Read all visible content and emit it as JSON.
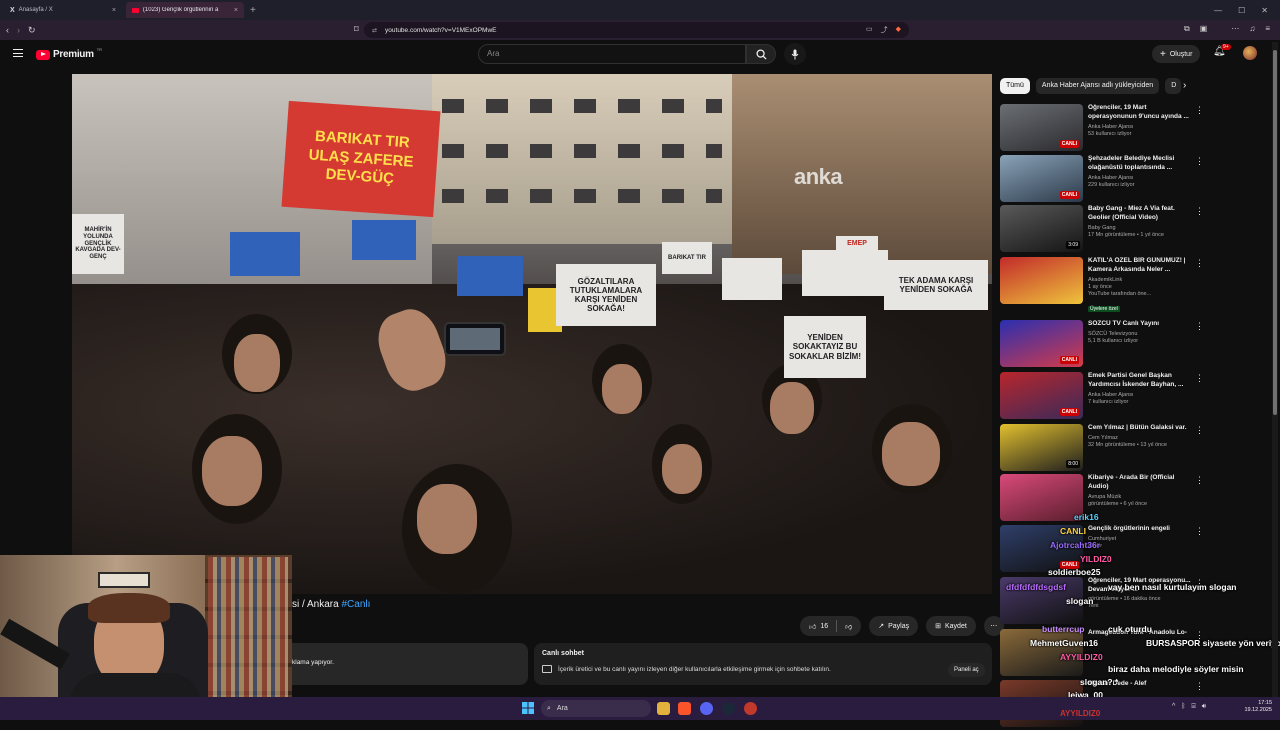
{
  "browser": {
    "tabs": [
      {
        "title": "Anasayfa / X",
        "icon": "x-logo-icon"
      },
      {
        "title": "(1023) Gençlik örgütlerinin a",
        "icon": "youtube-icon"
      }
    ],
    "url": "youtube.com/watch?v=V1MExOPMwE"
  },
  "header": {
    "logo": "Premium",
    "logo_region": "TR",
    "search_placeholder": "Ara",
    "create_label": "Oluştur",
    "notifications": "9+"
  },
  "video": {
    "watermark": "anka",
    "banner": [
      "BARIKAT TIR",
      "ULAŞ ZAFERE",
      "DEV-GÜÇ"
    ],
    "signs": [
      "MAHİR'İN YOLUNDA GENÇLİK KAVGADA DEV-GENÇ",
      "GÖZALTILARA TUTUKLAMALARA KARŞI YENİDEN SOKAĞA!",
      "TEK ADAMA KARŞI YENİDEN SOKAĞA",
      "YENİDEN SOKAKTAYIZ BU SOKAKLAR BİZİM!",
      "BARIKAT TIR",
      "EMEP"
    ],
    "title_visible": "si / Ankara ",
    "title_tag": "#Canlı",
    "likes": "16",
    "share": "Paylaş",
    "save": "Kaydet",
    "desc_visible": "klama yapıyor."
  },
  "live_chat": {
    "title": "Canlı sohbet",
    "desc": "İçerik üretici ve bu canlı yayını izleyen diğer kullanıcılarla etkileşime girmek için sohbete katılın.",
    "open_label": "Paneli aç"
  },
  "chips": [
    "Tümü",
    "Anka Haber Ajansı adlı yükleyiciden",
    "D"
  ],
  "recommended": [
    {
      "title": "Öğrenciler, 19 Mart operasyonunun 9'uncu ayında ...",
      "channel": "Anka Haber Ajansı",
      "meta": "53 kullanıcı izliyor",
      "badge": "CANLI",
      "extra": "",
      "green": ""
    },
    {
      "title": "Şehzadeler Belediye Meclisi olağanüstü toplantısında ...",
      "channel": "Anka Haber Ajansı",
      "meta": "229 kullanıcı izliyor",
      "badge": "CANLI",
      "extra": "",
      "green": ""
    },
    {
      "title": "Baby Gang - Miez A Via feat. Geolier (Official Video)",
      "channel": "Baby Gang",
      "meta": "17 Mn görüntüleme • 1 yıl önce",
      "badge": "3:09",
      "extra": "",
      "green": ""
    },
    {
      "title": "KATIL'A ÖZEL BİR GÜNÜMÜZ! | Kamera Arkasında Neler ...",
      "channel": "AkademikLink",
      "meta": "1 ay önce",
      "badge": "",
      "extra": "YouTube tarafından öne...",
      "green": "Üyelere özel"
    },
    {
      "title": "SÖZCÜ TV Canlı Yayını",
      "channel": "SÖZCÜ Televizyonu",
      "meta": "5,1 B kullanıcı izliyor",
      "badge": "CANLI",
      "extra": "",
      "green": ""
    },
    {
      "title": "Emek Partisi Genel Başkan Yardımcısı İskender Bayhan, ...",
      "channel": "Anka Haber Ajansı",
      "meta": "7 kullanıcı izliyor",
      "badge": "CANLI",
      "extra": "",
      "green": ""
    },
    {
      "title": "Cem Yılmaz | Bütün Galaksi var.",
      "channel": "Cem Yılmaz",
      "meta": "32 Mn görüntüleme • 13 yıl önce",
      "badge": "8:00",
      "extra": "",
      "green": ""
    },
    {
      "title": "Kibariye - Arada Bir (Official Audio)",
      "channel": "Avrupa Müzik",
      "meta": "görüntüleme • 6 yıl önce",
      "badge": "",
      "extra": "",
      "green": ""
    },
    {
      "title": "Gençlik örgütlerinin engeli",
      "channel": "Cumhuriyet",
      "meta": "izliyor",
      "badge": "CANLI",
      "extra": "",
      "green": ""
    },
    {
      "title": "Öğrenciler, 19 Mart operasyonu... Devam ediyor ...",
      "channel": "",
      "meta": "görüntüleme • 16 dakika önce",
      "badge": "",
      "extra": "Yeni",
      "green": ""
    },
    {
      "title": "Armageddon Turk - Anadolu Lo-",
      "channel": "",
      "meta": "",
      "badge": "",
      "extra": "",
      "green": ""
    },
    {
      "title": "Mercan Dede - Alef",
      "channel": "",
      "meta": "",
      "badge": "",
      "extra": "",
      "green": ""
    }
  ],
  "stream_chat": [
    {
      "text": "erik16",
      "color": "#5ad1ff"
    },
    {
      "text": "CANLI",
      "color": "#ffd23f"
    },
    {
      "text": "Ajotrcaht36r",
      "color": "#9b6bff"
    },
    {
      "text": "YILDIZ0",
      "color": "#ff5aa5"
    },
    {
      "text": "soldierboe25",
      "color": "#ffffff"
    },
    {
      "text": "dfdfdfdfdsgdsf",
      "color": "#b86bff"
    },
    {
      "text": "vay ben nasıl kurtulayım slogan",
      "color": "#ffffff"
    },
    {
      "text": "slogan",
      "color": "#ffffff"
    },
    {
      "text": "butterrcup",
      "color": "#c58cff"
    },
    {
      "text": "cuk oturdu",
      "color": "#ffffff"
    },
    {
      "text": "MehmetGuven16",
      "color": "#ffffff"
    },
    {
      "text": "BURSASPOR siyasete yön veriyor",
      "color": "#ffffff"
    },
    {
      "text": "AYYILDIZ0",
      "color": "#ff5aa5"
    },
    {
      "text": "biraz daha melodiyle söyler misin",
      "color": "#ffffff"
    },
    {
      "text": "slogan? *",
      "color": "#ffffff"
    },
    {
      "text": "leiwa_00",
      "color": "#ffffff"
    },
    {
      "text": "AYYILDIZ0",
      "color": "#ff4d4d"
    }
  ],
  "taskbar": {
    "search": "Ara",
    "time": "17:15",
    "date": "19.12.2025"
  }
}
